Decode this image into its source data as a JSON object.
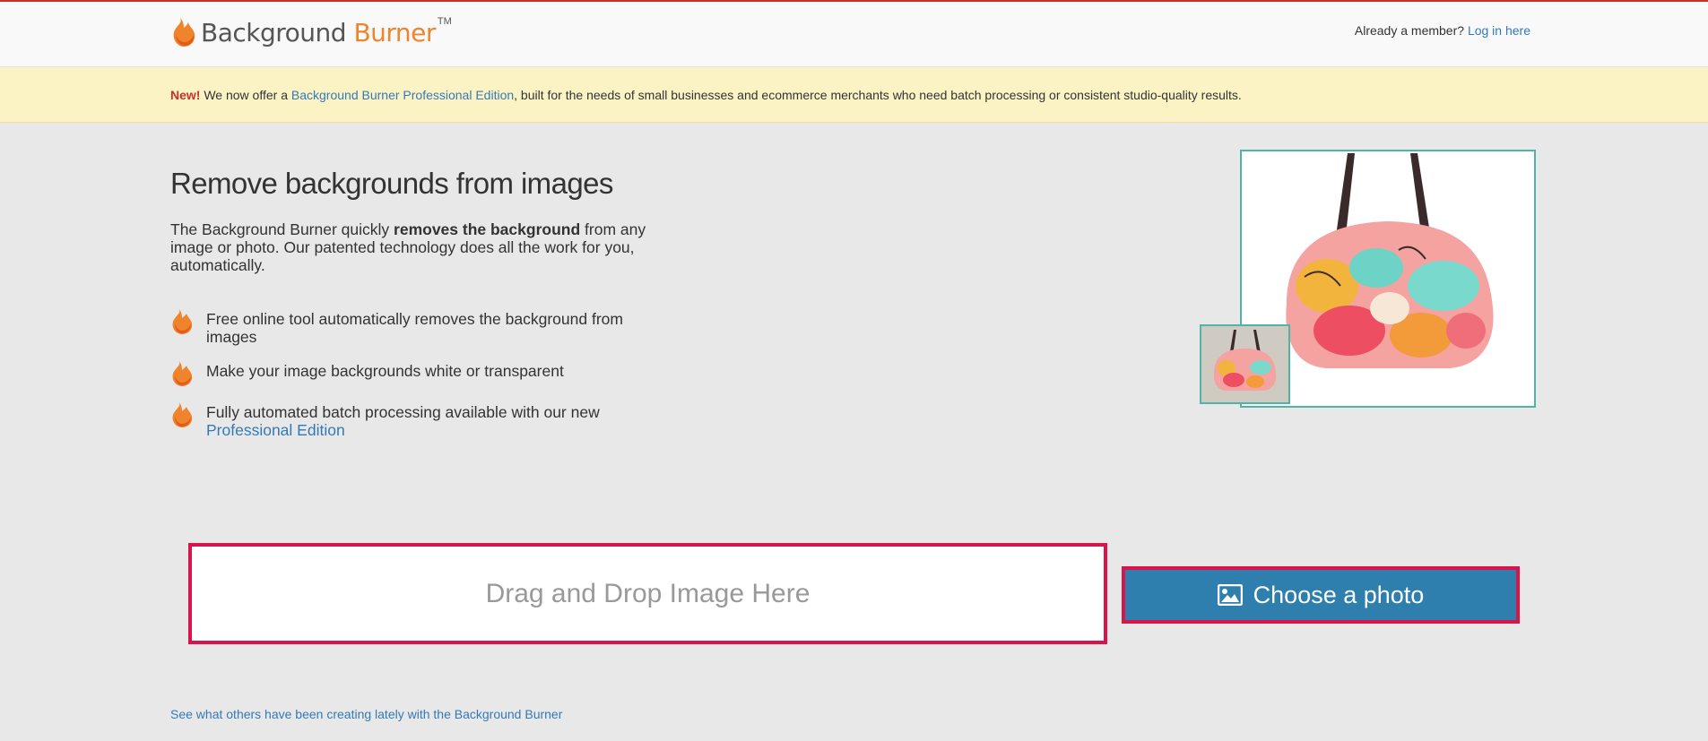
{
  "header": {
    "logo": {
      "word1": "Background",
      "word2": "Burner",
      "tm": "TM"
    },
    "member_text": "Already a member?",
    "login_link": "Log in here"
  },
  "announcement": {
    "badge": "New!",
    "text_before": "We now offer a",
    "link": "Background Burner Professional Edition",
    "text_after": ", built for the needs of small businesses and ecommerce merchants who need batch processing or consistent studio-quality results."
  },
  "hero": {
    "title": "Remove backgrounds from images",
    "desc_before": "The Background Burner quickly",
    "desc_bold": "removes the background",
    "desc_after": "from any image or photo. Our patented technology does all the work for you, automatically.",
    "features": [
      {
        "text": "Free online tool automatically removes the background from images"
      },
      {
        "text": "Make your image backgrounds white or transparent"
      },
      {
        "text": "Fully automated batch processing available with our new",
        "link": "Professional Edition"
      }
    ]
  },
  "upload": {
    "dropzone_label": "Drag and Drop Image Here",
    "choose_label": "Choose a photo",
    "choose_icon": "image-icon"
  },
  "footer": {
    "link": "See what others have been creating lately with the Background Burner"
  },
  "colors": {
    "accent": "#f0842c",
    "link": "#337ab7",
    "button": "#2e7eae",
    "highlight_border": "#d8144b",
    "announce_bg": "#fcf3c5"
  }
}
